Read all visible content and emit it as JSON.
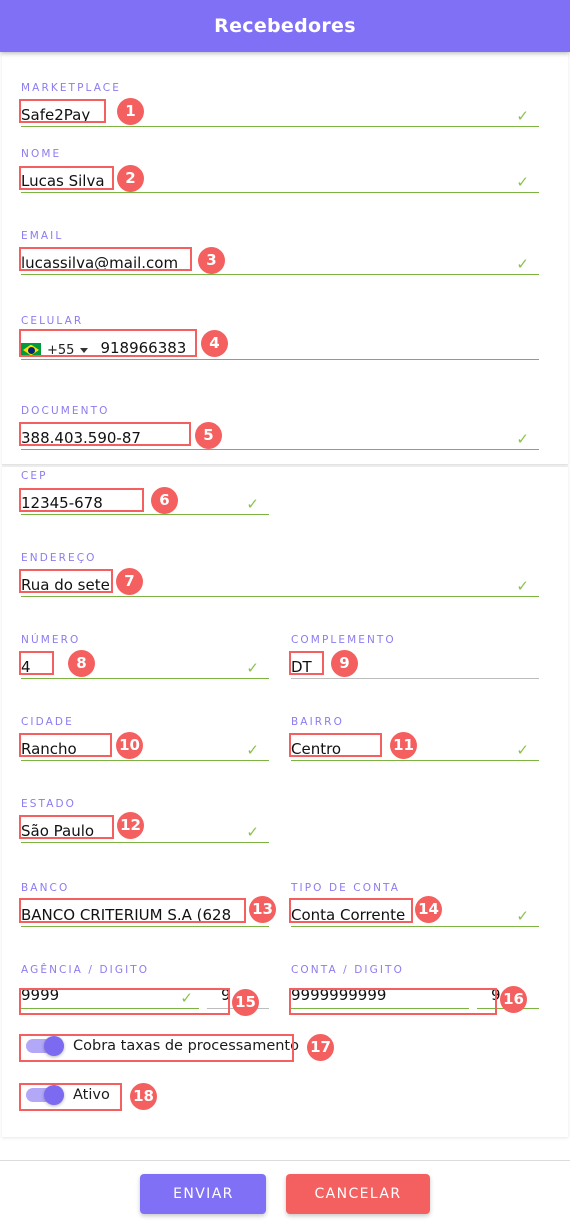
{
  "header": {
    "title": "Recebedores"
  },
  "fields": [
    {
      "label": "MARKETPLACE",
      "value": "Safe2Pay",
      "state": "valid"
    },
    {
      "label": "NOME",
      "value": "Lucas Silva",
      "state": "valid"
    },
    {
      "label": "EMAIL",
      "value": "lucassilva@mail.com",
      "state": "valid"
    },
    {
      "label": "CELULAR",
      "value": "918966383",
      "state": "valid",
      "country_code": "+55",
      "flag": "brazil-flag-icon"
    },
    {
      "label": "DOCUMENTO",
      "value": "388.403.590-87",
      "state": "valid"
    },
    {
      "label": "CEP",
      "value": "12345-678",
      "state": "valid"
    },
    {
      "label": "ENDEREÇO",
      "value": "Rua do sete",
      "state": "valid"
    },
    {
      "label": "NÚMERO",
      "value": "4",
      "state": "valid"
    },
    {
      "label": "COMPLEMENTO",
      "value": "DT",
      "state": "neutral"
    },
    {
      "label": "CIDADE",
      "value": "Rancho",
      "state": "valid"
    },
    {
      "label": "BAIRRO",
      "value": "Centro",
      "state": "valid"
    },
    {
      "label": "ESTADO",
      "value": "São Paulo",
      "state": "valid"
    },
    {
      "label": "BANCO",
      "value": "BANCO CRITERIUM S.A (628",
      "state": "valid"
    },
    {
      "label": "TIPO DE CONTA",
      "value": "Conta Corrente",
      "state": "valid"
    },
    {
      "label": "AGÊNCIA / DIGITO",
      "value": "9999",
      "digit": "9",
      "state": "valid"
    },
    {
      "label": "CONTA / DIGITO",
      "value": "9999999999",
      "digit": "9",
      "state": "valid"
    }
  ],
  "toggles": [
    {
      "label": "Cobra taxas de processamento",
      "on": true
    },
    {
      "label": "Ativo",
      "on": true
    }
  ],
  "footer": {
    "submit_label": "ENVIAR",
    "cancel_label": "CANCELAR"
  },
  "annotations": {
    "numbers": [
      "1",
      "2",
      "3",
      "4",
      "5",
      "6",
      "7",
      "8",
      "9",
      "10",
      "11",
      "12",
      "13",
      "14",
      "15",
      "16",
      "17",
      "18"
    ],
    "color": "#f4605f"
  },
  "colors": {
    "brand_purple": "#8070f5",
    "label_purple": "#8b7cf0",
    "valid_green": "#7cb342",
    "annotation_red": "#f4605f",
    "neutral_gray": "#bdbdbd"
  }
}
